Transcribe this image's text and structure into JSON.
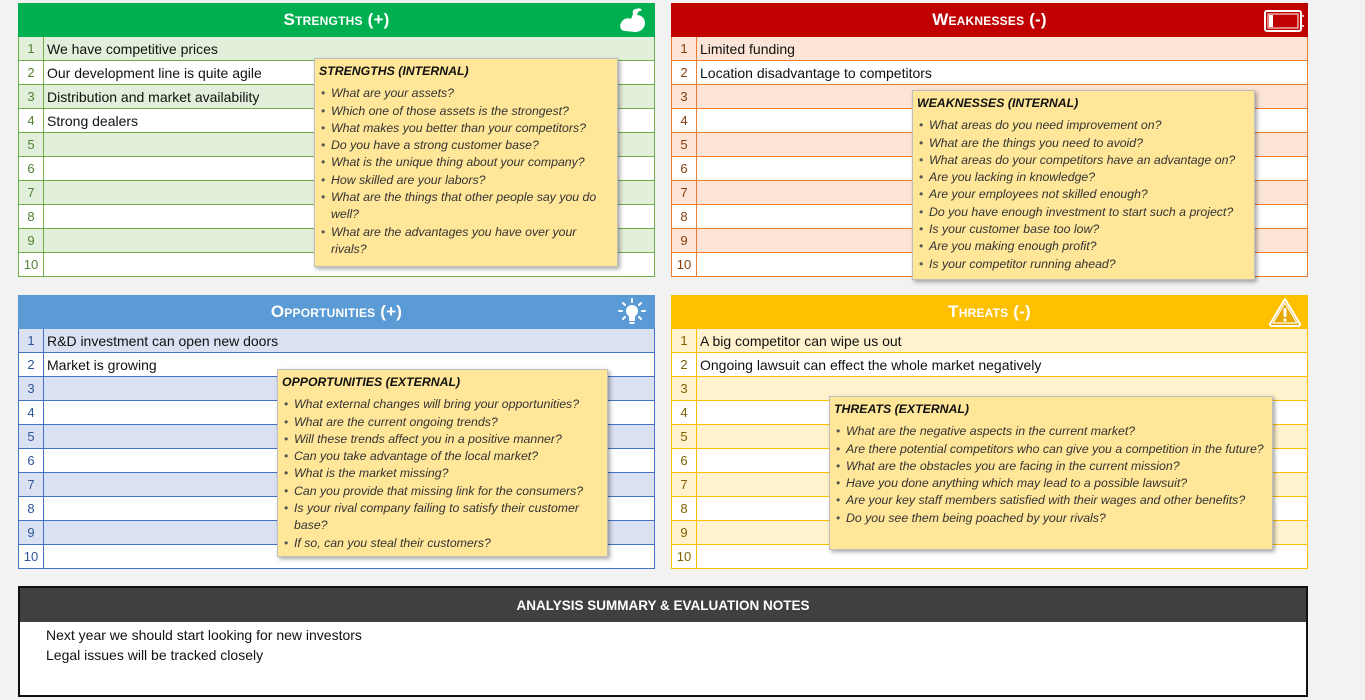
{
  "strengths": {
    "title": "Strengths (+)",
    "icon": "flexed-bicep-icon",
    "rows": [
      {
        "num": "1",
        "text": "We have competitive prices"
      },
      {
        "num": "2",
        "text": "Our development line is quite agile"
      },
      {
        "num": "3",
        "text": "Distribution and market availability"
      },
      {
        "num": "4",
        "text": "Strong dealers"
      },
      {
        "num": "5",
        "text": ""
      },
      {
        "num": "6",
        "text": ""
      },
      {
        "num": "7",
        "text": ""
      },
      {
        "num": "8",
        "text": ""
      },
      {
        "num": "9",
        "text": ""
      },
      {
        "num": "10",
        "text": ""
      }
    ],
    "note": {
      "title": "STRENGTHS (INTERNAL)",
      "items": [
        "What are your assets?",
        "Which one of those assets is the strongest?",
        "What makes you better than your competitors?",
        "Do you have a strong customer base?",
        "What is the unique thing about your company?",
        "How skilled are your labors?",
        "What are the things that other people say you do well?",
        "What are the advantages you have over your rivals?"
      ]
    },
    "color": "#00b050"
  },
  "weaknesses": {
    "title": "Weaknesses (-)",
    "icon": "low-battery-icon",
    "rows": [
      {
        "num": "1",
        "text": "Limited funding"
      },
      {
        "num": "2",
        "text": "Location disadvantage to competitors"
      },
      {
        "num": "3",
        "text": ""
      },
      {
        "num": "4",
        "text": ""
      },
      {
        "num": "5",
        "text": ""
      },
      {
        "num": "6",
        "text": ""
      },
      {
        "num": "7",
        "text": ""
      },
      {
        "num": "8",
        "text": ""
      },
      {
        "num": "9",
        "text": ""
      },
      {
        "num": "10",
        "text": ""
      }
    ],
    "note": {
      "title": "WEAKNESSES (INTERNAL)",
      "items": [
        "What areas do you need improvement on?",
        "What are the things you need to avoid?",
        "What areas do your competitors have an advantage on?",
        "Are you lacking in knowledge?",
        "Are your employees not skilled enough?",
        "Do you have enough investment to start such a project?",
        "Is your customer base too low?",
        "Are you making enough profit?",
        "Is your competitor running ahead?"
      ]
    },
    "color": "#c00000"
  },
  "opportunities": {
    "title": "Opportunities (+)",
    "icon": "lightbulb-icon",
    "rows": [
      {
        "num": "1",
        "text": "R&D investment can open new doors"
      },
      {
        "num": "2",
        "text": "Market is growing"
      },
      {
        "num": "3",
        "text": ""
      },
      {
        "num": "4",
        "text": ""
      },
      {
        "num": "5",
        "text": ""
      },
      {
        "num": "6",
        "text": ""
      },
      {
        "num": "7",
        "text": ""
      },
      {
        "num": "8",
        "text": ""
      },
      {
        "num": "9",
        "text": ""
      },
      {
        "num": "10",
        "text": ""
      }
    ],
    "note": {
      "title": "OPPORTUNITIES (EXTERNAL)",
      "items": [
        "What external changes will bring your opportunities?",
        "What are the current ongoing trends?",
        "Will these trends affect you in a positive manner?",
        "Can you take advantage of the local market?",
        "What is the market missing?",
        "Can you provide that missing link for the consumers?",
        "Is your rival company failing to satisfy their customer base?",
        "If so, can you steal their customers?"
      ]
    },
    "color": "#5b9bd5"
  },
  "threats": {
    "title": "Threats (-)",
    "icon": "warning-icon",
    "rows": [
      {
        "num": "1",
        "text": "A big competitor can wipe us out"
      },
      {
        "num": "2",
        "text": "Ongoing lawsuit can effect the whole market negatively"
      },
      {
        "num": "3",
        "text": ""
      },
      {
        "num": "4",
        "text": ""
      },
      {
        "num": "5",
        "text": ""
      },
      {
        "num": "6",
        "text": ""
      },
      {
        "num": "7",
        "text": ""
      },
      {
        "num": "8",
        "text": ""
      },
      {
        "num": "9",
        "text": ""
      },
      {
        "num": "10",
        "text": ""
      }
    ],
    "note": {
      "title": "THREATS (EXTERNAL)",
      "items": [
        "What are the negative aspects in the current market?",
        "Are there potential competitors who can give you a competition in the future?",
        "What are the obstacles you are facing in the current mission?",
        "Have you done anything which may lead to a possible lawsuit?",
        "Are your key staff members satisfied with their wages and other benefits?",
        "Do you see them being poached by your rivals?"
      ]
    },
    "color": "#ffc000"
  },
  "summary": {
    "title": "ANALYSIS SUMMARY & EVALUATION NOTES",
    "lines": [
      "Next year we should start looking for new investors",
      "Legal issues will be tracked closely"
    ]
  }
}
